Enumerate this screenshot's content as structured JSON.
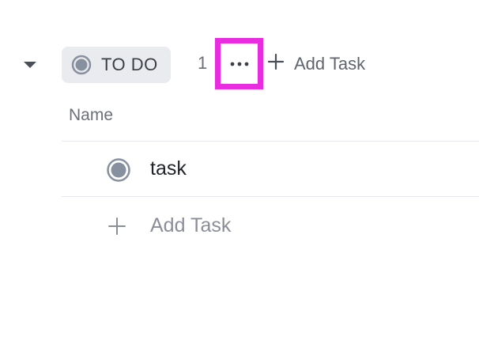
{
  "group": {
    "status_label": "TO DO",
    "status_color": "#87909e",
    "task_count": "1",
    "more_icon": "ellipsis-icon",
    "add_task_label": "Add Task"
  },
  "table": {
    "columns": [
      {
        "label": "Name"
      }
    ],
    "rows": [
      {
        "name": "task",
        "status_icon": "status-circle-icon"
      }
    ],
    "add_task_label": "Add Task"
  },
  "colors": {
    "highlight_border": "#ea2ce0",
    "pill_background": "#eaebee"
  }
}
